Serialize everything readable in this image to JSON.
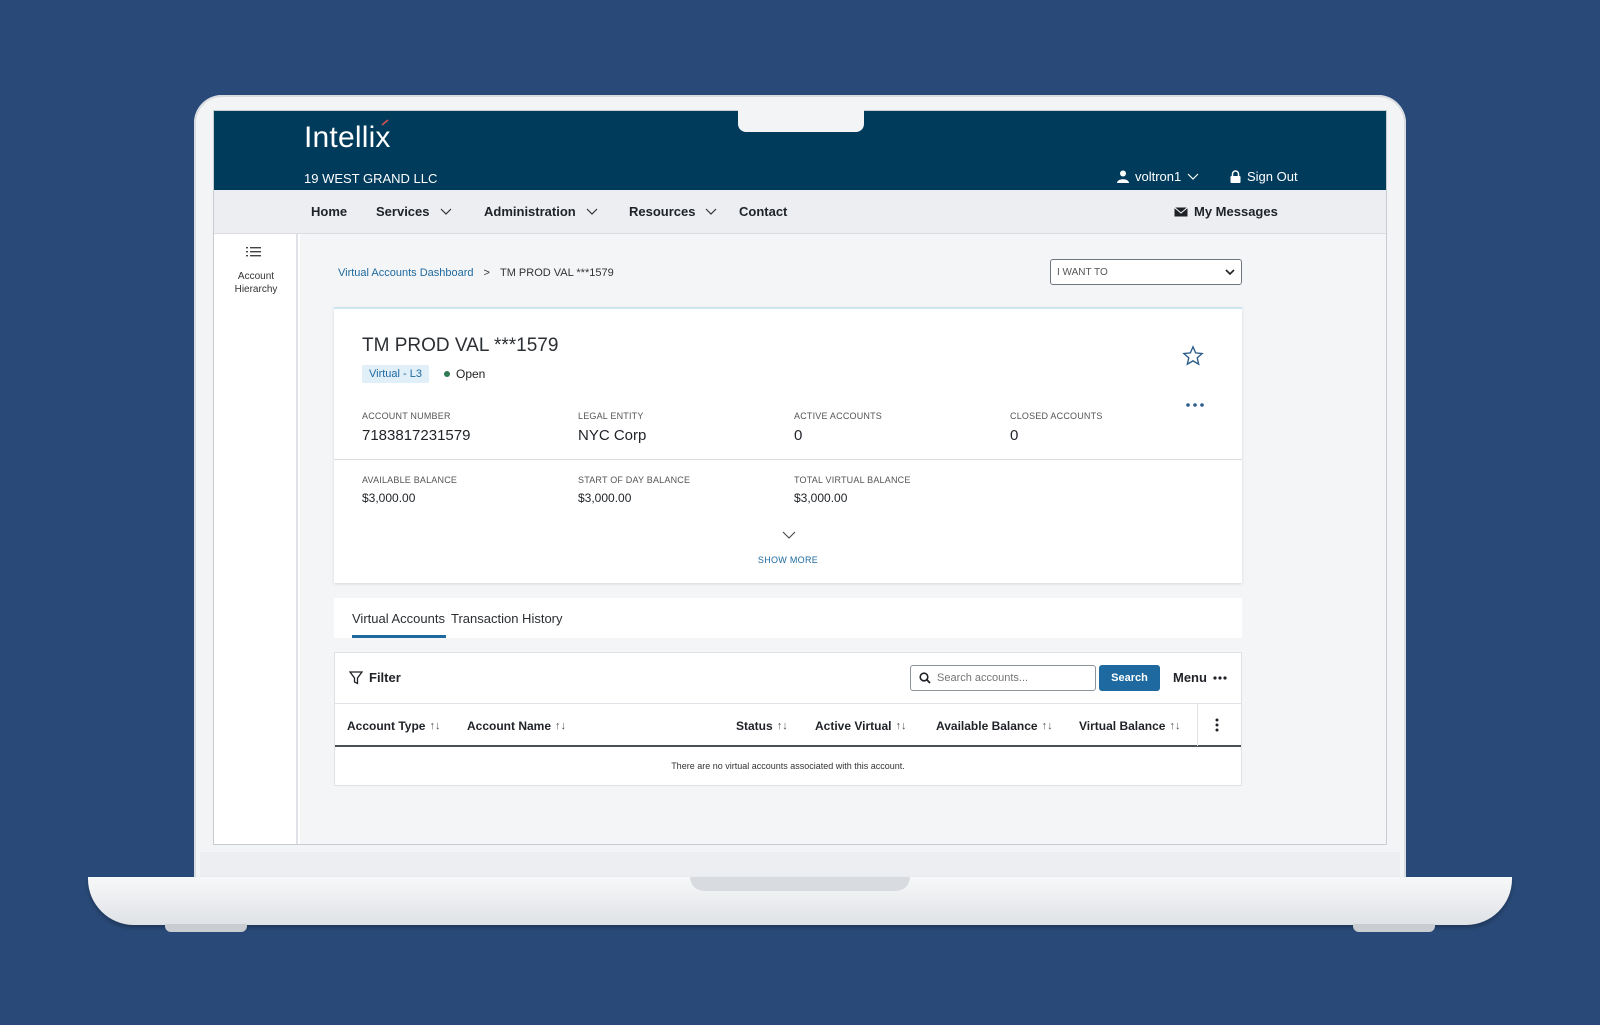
{
  "header": {
    "logo": "Intellix",
    "company": "19 WEST GRAND LLC",
    "username": "voltron1",
    "sign_out": "Sign Out"
  },
  "nav": {
    "items": [
      {
        "label": "Home"
      },
      {
        "label": "Services"
      },
      {
        "label": "Administration"
      },
      {
        "label": "Resources"
      },
      {
        "label": "Contact"
      }
    ],
    "messages": "My Messages"
  },
  "sidebar": {
    "label": "Account Hierarchy"
  },
  "breadcrumb": {
    "parent": "Virtual Accounts Dashboard",
    "separator": ">",
    "current": "TM PROD VAL ***1579"
  },
  "actions": {
    "i_want_to": "I WANT TO"
  },
  "account": {
    "title": "TM PROD VAL ***1579",
    "badge": "Virtual - L3",
    "status": "Open",
    "fields": {
      "account_number_label": "ACCOUNT NUMBER",
      "account_number": "7183817231579",
      "legal_entity_label": "LEGAL ENTITY",
      "legal_entity": "NYC Corp",
      "active_accounts_label": "ACTIVE ACCOUNTS",
      "active_accounts": "0",
      "closed_accounts_label": "CLOSED ACCOUNTS",
      "closed_accounts": "0",
      "available_balance_label": "AVAILABLE BALANCE",
      "available_balance": "$3,000.00",
      "start_of_day_label": "START OF DAY BALANCE",
      "start_of_day": "$3,000.00",
      "total_virtual_label": "TOTAL VIRTUAL BALANCE",
      "total_virtual": "$3,000.00"
    },
    "show_more": "SHOW MORE"
  },
  "tabs": [
    {
      "label": "Virtual Accounts",
      "active": true
    },
    {
      "label": "Transaction History",
      "active": false
    }
  ],
  "grid": {
    "filter": "Filter",
    "search_placeholder": "Search accounts...",
    "search_button": "Search",
    "menu": "Menu",
    "columns": [
      {
        "label": "Account Type"
      },
      {
        "label": "Account Name"
      },
      {
        "label": "Status"
      },
      {
        "label": "Active Virtual"
      },
      {
        "label": "Available Balance"
      },
      {
        "label": "Virtual Balance"
      }
    ],
    "sort_glyph": "↑↓",
    "empty_message": "There are no virtual accounts associated with this account."
  },
  "colors": {
    "background": "#294a78",
    "header": "#003b5c",
    "accent": "#1e6aa0",
    "status_open": "#2f7a55"
  }
}
